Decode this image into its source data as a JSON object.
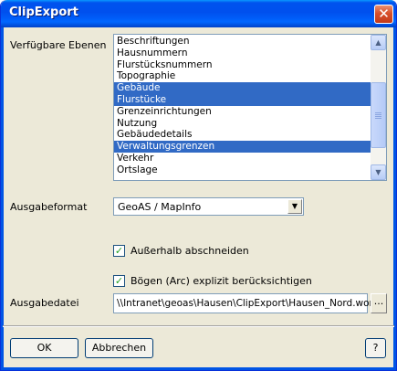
{
  "window": {
    "title": "ClipExport",
    "close_glyph": "✕"
  },
  "labels": {
    "layers": "Verfügbare Ebenen",
    "format": "Ausgabeformat",
    "file": "Ausgabedatei"
  },
  "layers": {
    "items": [
      {
        "label": "Beschriftungen",
        "selected": false
      },
      {
        "label": "Hausnummern",
        "selected": false
      },
      {
        "label": "Flurstücksnummern",
        "selected": false
      },
      {
        "label": "Topographie",
        "selected": false
      },
      {
        "label": "Gebäude",
        "selected": true
      },
      {
        "label": "Flurstücke",
        "selected": true
      },
      {
        "label": "Grenzeinrichtungen",
        "selected": false
      },
      {
        "label": "Nutzung",
        "selected": false
      },
      {
        "label": "Gebäudedetails",
        "selected": false
      },
      {
        "label": "Verwaltungsgrenzen",
        "selected": true
      },
      {
        "label": "Verkehr",
        "selected": false
      },
      {
        "label": "Ortslage",
        "selected": false
      }
    ],
    "selection_color": "#316ac5"
  },
  "format": {
    "value": "GeoAS / MapInfo"
  },
  "options": {
    "clip_outside": {
      "label": "Außerhalb abschneiden",
      "checked": true
    },
    "arc": {
      "label": "Bögen (Arc) explizit berücksichtigen",
      "checked": true
    }
  },
  "file": {
    "value": "\\\\Intranet\\geoas\\Hausen\\ClipExport\\Hausen_Nord.wor",
    "browse": "..."
  },
  "buttons": {
    "ok": "OK",
    "cancel": "Abbrechen",
    "help": "?"
  },
  "icons": {
    "scroll_up": "▲",
    "scroll_down": "▼",
    "dropdown": "▼",
    "check": "✓"
  },
  "colors": {
    "titlebar": "#0054e3",
    "face": "#ece9d8"
  }
}
